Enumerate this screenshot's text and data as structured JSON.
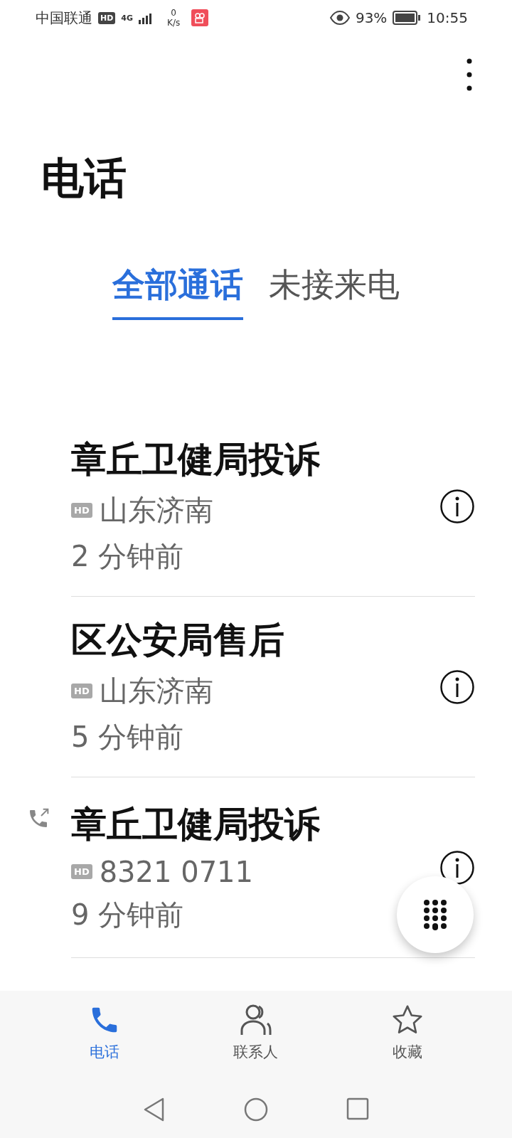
{
  "status_bar": {
    "carrier": "中国联通",
    "hd_badge": "HD",
    "network": "4G",
    "speed_value": "0",
    "speed_unit": "K/s",
    "battery": "93%",
    "time": "10:55"
  },
  "title": "电话",
  "tabs": [
    {
      "label": "全部通话",
      "selected": true
    },
    {
      "label": "未接来电",
      "selected": false
    }
  ],
  "calls": [
    {
      "name": "章丘卫健局投诉",
      "badge": "HD",
      "detail": "山东济南",
      "time": "2 分钟前",
      "outgoing": false
    },
    {
      "name": "区公安局售后",
      "badge": "HD",
      "detail": "山东济南",
      "time": "5 分钟前",
      "outgoing": false
    },
    {
      "name": "章丘卫健局投诉",
      "badge": "HD",
      "detail": "8321 0711",
      "time": "9 分钟前",
      "outgoing": true
    }
  ],
  "bottom_nav": [
    {
      "label": "电话",
      "kind": "phone",
      "selected": true
    },
    {
      "label": "联系人",
      "kind": "contacts",
      "selected": false
    },
    {
      "label": "收藏",
      "kind": "favorites",
      "selected": false
    }
  ]
}
